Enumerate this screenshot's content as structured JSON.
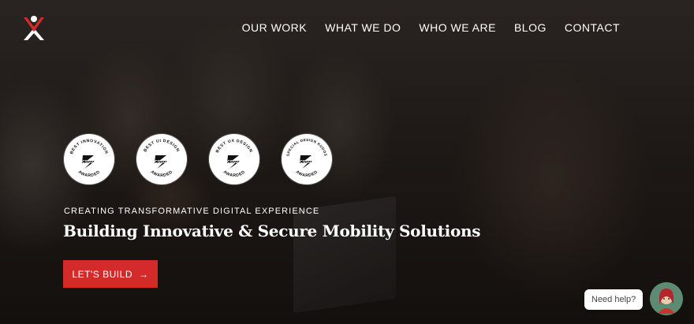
{
  "nav": {
    "items": [
      {
        "label": "OUR WORK"
      },
      {
        "label": "WHAT WE DO"
      },
      {
        "label": "WHO WE ARE"
      },
      {
        "label": "BLOG"
      },
      {
        "label": "CONTACT"
      }
    ]
  },
  "badges": [
    {
      "top": "BEST INNOVATION",
      "brand": "CSSDA",
      "bottom": "AWARDED"
    },
    {
      "top": "BEST UI DESIGN",
      "brand": "CSSDA",
      "bottom": "AWARDED"
    },
    {
      "top": "BEST UX DESIGN",
      "brand": "CSSDA",
      "bottom": "AWARDED"
    },
    {
      "top": "SPECIAL DESIGN KUDOS",
      "brand": "CSSDA",
      "bottom": "AWARDED"
    }
  ],
  "hero": {
    "eyebrow": "CREATING TRANSFORMATIVE DIGITAL EXPERIENCE",
    "headline": "Building Innovative & Secure Mobility Solutions",
    "cta_label": "LET'S BUILD",
    "cta_icon": "→"
  },
  "chat": {
    "bubble_text": "Need help?"
  },
  "colors": {
    "accent": "#d42a2a",
    "text": "#ffffff"
  }
}
